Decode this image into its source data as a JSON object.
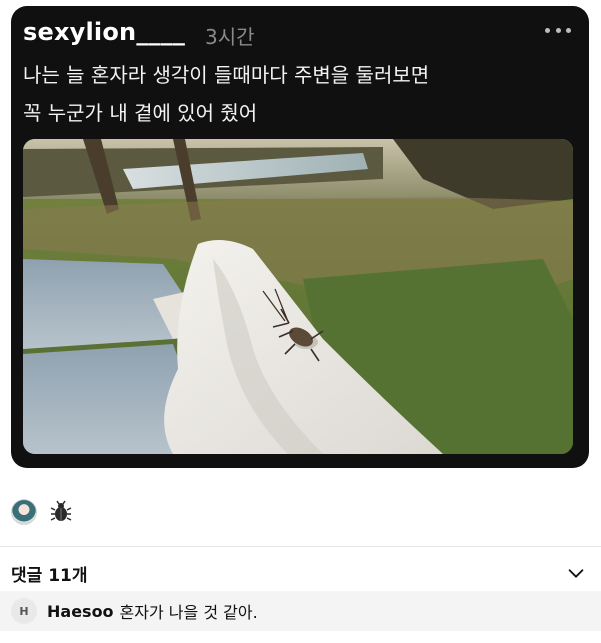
{
  "post": {
    "username": "sexylion____",
    "timestamp": "3시간",
    "text_line1": "나는 늘 혼자라 생각이 들때마다 주변을 둘러보면",
    "text_line2": "꼭 누군가 내 곁에 있어 줬어"
  },
  "media": {
    "description_icon": "photo-insect-on-sleeve"
  },
  "reactions": {
    "avatar_icon": "avatar",
    "bug_icon": "bug-icon"
  },
  "comments": {
    "count_label": "댓글 11개",
    "items": [
      {
        "avatar_initial": "H",
        "author": "Haesoo",
        "text": "혼자가 나을 것 같아."
      }
    ]
  },
  "colors": {
    "card_bg": "#101010",
    "timestamp": "#8a8a8a",
    "comment_row_bg": "#f4f4f4"
  }
}
